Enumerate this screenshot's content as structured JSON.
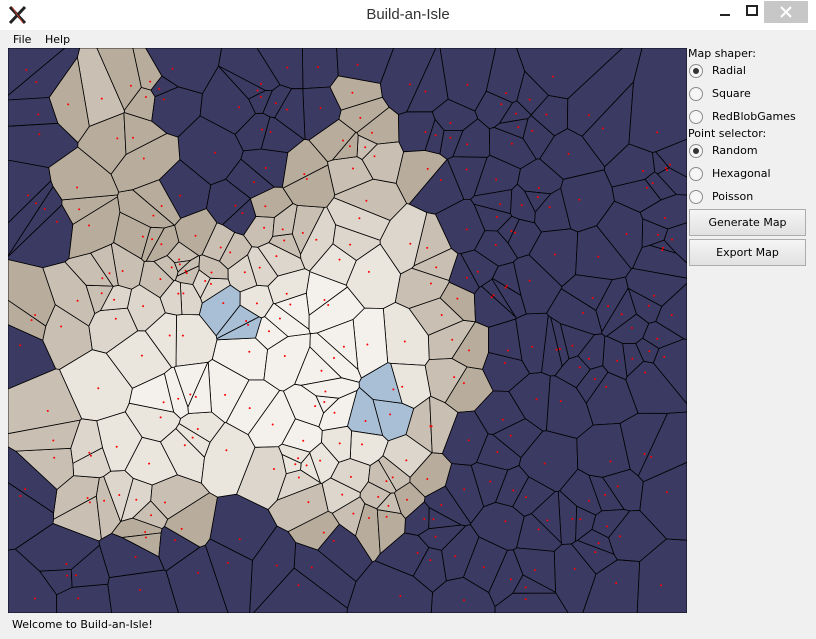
{
  "window": {
    "title": "Build-an-Isle"
  },
  "menu": {
    "items": [
      {
        "label": "File"
      },
      {
        "label": "Help"
      }
    ]
  },
  "map": {
    "colors": {
      "ocean": "#3b3a63",
      "lake": "#a9bfd6",
      "beach": "#b8ac9c",
      "low": "#c9bfb3",
      "mid": "#ddd6cc",
      "high": "#eae5dd",
      "peak": "#f4f1ec",
      "edge": "#000000",
      "point": "#ff0000"
    }
  },
  "controls": {
    "shaper_label": "Map shaper:",
    "shaper_options": [
      {
        "label": "Radial",
        "selected": true
      },
      {
        "label": "Square",
        "selected": false
      },
      {
        "label": "RedBlobGames",
        "selected": false
      }
    ],
    "selector_label": "Point selector:",
    "selector_options": [
      {
        "label": "Random",
        "selected": true
      },
      {
        "label": "Hexagonal",
        "selected": false
      },
      {
        "label": "Poisson",
        "selected": false
      }
    ],
    "generate_label": "Generate Map",
    "export_label": "Export Map"
  },
  "status": {
    "text": "Welcome to Build-an-Isle!"
  }
}
